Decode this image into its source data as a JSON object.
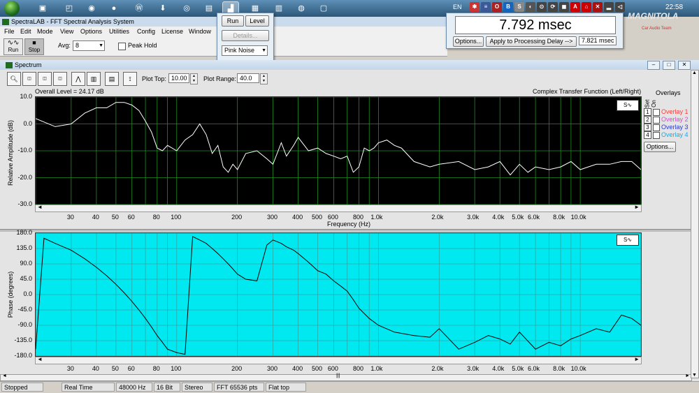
{
  "taskbar": {
    "language": "EN",
    "clock": "22:58",
    "brand": "MAGNITOLA",
    "brand_sub": "Car Audio Team"
  },
  "app": {
    "title": "SpectraLAB - FFT Spectral Analysis System",
    "menu": [
      "File",
      "Edit",
      "Mode",
      "View",
      "Options",
      "Utilities",
      "Config",
      "License",
      "Window"
    ],
    "toolbar": {
      "run_label": "Run",
      "stop_label": "Stop",
      "avg_label": "Avg:",
      "avg_value": "8",
      "peak_hold_label": "Peak Hold"
    }
  },
  "run_panel": {
    "run_label": "Run",
    "level_label": "Level",
    "details_label": "Details...",
    "generator_value": "Pink Noise"
  },
  "delay_panel": {
    "delay_value": "7.792 msec",
    "options_label": "Options...",
    "apply_label": "Apply to Processing Delay -->",
    "applied_value": "7.821 msec"
  },
  "spectrum": {
    "window_title": "Spectrum",
    "plot_top_label": "Plot Top:",
    "plot_top_value": "10.00",
    "plot_range_label": "Plot Range:",
    "plot_range_value": "40.0",
    "overall_level": "Overall Level = 24.17 dB",
    "transfer_label": "Complex Transfer Function (Left/Right)",
    "overlays": {
      "title": "Overlays",
      "set_label": "Set",
      "on_label": "On",
      "items": [
        {
          "num": "1",
          "label": "Overlay 1",
          "color": "#ff3a3a"
        },
        {
          "num": "2",
          "label": "Overlay 2",
          "color": "#d64ad6"
        },
        {
          "num": "3",
          "label": "Overlay 3",
          "color": "#2a3ad6"
        },
        {
          "num": "4",
          "label": "Overlay 4",
          "color": "#1aa8e6"
        }
      ],
      "options_label": "Options..."
    },
    "amp": {
      "ylabel": "Relative Amplitude (dB)",
      "yticks": [
        "10.0",
        "0.0",
        "-10.0",
        "-20.0",
        "-30.0"
      ],
      "xlabel": "Frequency (Hz)",
      "bg_color": "#000000",
      "grid_color": "#1f8f1f",
      "trace_color": "#ffffff"
    },
    "phase": {
      "ylabel": "Phase (degrees)",
      "yticks": [
        "180.0",
        "135.0",
        "90.0",
        "45.0",
        "0.0",
        "-45.0",
        "-90.0",
        "-135.0",
        "-180.0"
      ],
      "bg_color": "#00e8f0",
      "grid_color": "#2ea8a8",
      "trace_color": "#000000"
    },
    "xticks": [
      "30",
      "40",
      "50",
      "60",
      "80",
      "100",
      "200",
      "300",
      "400",
      "500",
      "600",
      "800",
      "1.0k",
      "2.0k",
      "3.0k",
      "4.0k",
      "5.0k",
      "6.0k",
      "8.0k",
      "10.0k"
    ]
  },
  "statusbar": {
    "items": [
      "Stopped",
      "Real Time",
      "48000 Hz",
      "16 Bit",
      "Stereo",
      "FFT 65536 pts",
      "Flat top"
    ]
  },
  "chart_data": [
    {
      "type": "line",
      "xlabel": "Frequency (Hz)",
      "ylabel": "Relative Amplitude (dB)",
      "xscale": "log",
      "xlim": [
        20,
        20000
      ],
      "ylim": [
        -30,
        10
      ],
      "grid": true,
      "series": [
        {
          "x": [
            20,
            25,
            30,
            35,
            40,
            45,
            50,
            55,
            60,
            65,
            70,
            75,
            80,
            85,
            90,
            100,
            110,
            120,
            130,
            140,
            150,
            160,
            170,
            180,
            190,
            200,
            220,
            250,
            280,
            300,
            330,
            350,
            380,
            400,
            450,
            500,
            550,
            600,
            650,
            700,
            750,
            800,
            850,
            900,
            950,
            1000,
            1100,
            1200,
            1300,
            1500,
            1800,
            2000,
            2500,
            3000,
            3500,
            4000,
            4500,
            5000,
            5500,
            6000,
            7000,
            8000,
            9000,
            10000,
            12000,
            14000,
            16000,
            18000,
            20000
          ],
          "y": [
            2,
            -1,
            0,
            4,
            6,
            6,
            8,
            8,
            7,
            5,
            1,
            -3,
            -9,
            -10,
            -8,
            -10,
            -6,
            -4,
            0,
            -4,
            -11,
            -8,
            -16,
            -18,
            -15,
            -17,
            -11,
            -10,
            -13,
            -15,
            -7,
            -12,
            -8,
            -5,
            -10,
            -9,
            -11,
            -12,
            -13,
            -12,
            -18,
            -16,
            -9,
            -10,
            -9,
            -7,
            -6,
            -8,
            -9,
            -14,
            -16,
            -15,
            -14,
            -17,
            -16,
            -14,
            -19,
            -15,
            -18,
            -16,
            -17,
            -16,
            -14,
            -17,
            -15,
            -15,
            -14,
            -14,
            -17
          ]
        }
      ]
    },
    {
      "type": "line",
      "ylabel": "Phase (degrees)",
      "xscale": "log",
      "xlim": [
        20,
        20000
      ],
      "ylim": [
        -180,
        180
      ],
      "grid": true,
      "series": [
        {
          "x": [
            20,
            22,
            25,
            30,
            35,
            40,
            45,
            50,
            55,
            60,
            65,
            70,
            75,
            80,
            85,
            90,
            100,
            110,
            120,
            130,
            140,
            150,
            160,
            170,
            180,
            190,
            200,
            220,
            250,
            280,
            300,
            330,
            350,
            380,
            400,
            450,
            500,
            550,
            600,
            650,
            700,
            750,
            800,
            900,
            1000,
            1200,
            1500,
            1800,
            2000,
            2500,
            3000,
            3500,
            4000,
            4500,
            5000,
            6000,
            7000,
            8000,
            9000,
            10000,
            12000,
            14000,
            16000,
            18000,
            20000
          ],
          "y": [
            -160,
            165,
            150,
            130,
            105,
            80,
            55,
            30,
            5,
            -20,
            -45,
            -70,
            -95,
            -120,
            -140,
            -160,
            -170,
            -175,
            170,
            160,
            150,
            135,
            120,
            105,
            90,
            75,
            60,
            45,
            40,
            145,
            160,
            150,
            140,
            130,
            120,
            95,
            70,
            60,
            40,
            25,
            10,
            -15,
            -40,
            -70,
            -90,
            -110,
            -120,
            -125,
            -100,
            -160,
            -140,
            -120,
            -130,
            -145,
            -110,
            -160,
            -140,
            -150,
            -130,
            -120,
            -100,
            -110,
            -60,
            -70,
            -90
          ]
        }
      ]
    }
  ]
}
